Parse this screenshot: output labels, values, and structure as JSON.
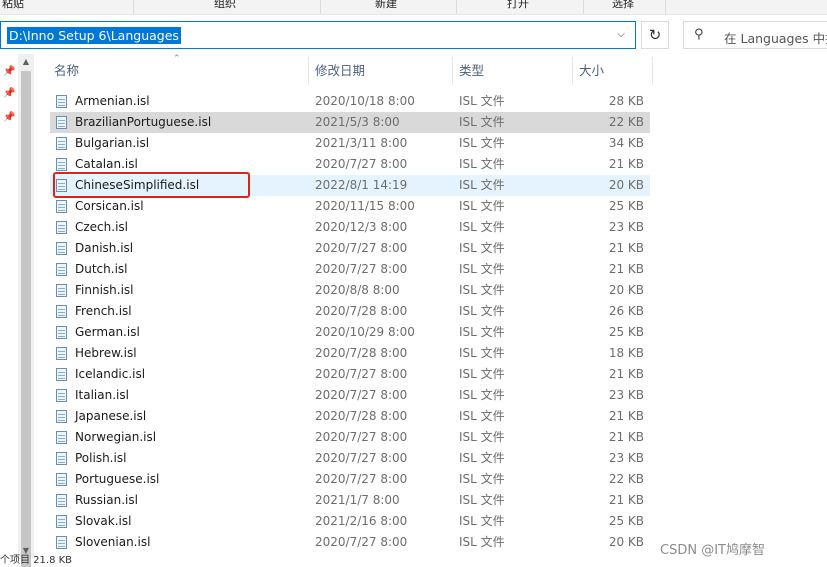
{
  "ribbon": {
    "groups": [
      "粘贴",
      "组织",
      "新建",
      "打开",
      "选择"
    ]
  },
  "address_bar": {
    "path": "D:\\Inno Setup 6\\Languages"
  },
  "search": {
    "placeholder": "在 Languages 中搜"
  },
  "columns": {
    "name": "名称",
    "modified": "修改日期",
    "type": "类型",
    "size": "大小"
  },
  "files": [
    {
      "name": "Armenian.isl",
      "modified": "2020/10/18 8:00",
      "type": "ISL 文件",
      "size": "28 KB"
    },
    {
      "name": "BrazilianPortuguese.isl",
      "modified": "2021/5/3 8:00",
      "type": "ISL 文件",
      "size": "22 KB"
    },
    {
      "name": "Bulgarian.isl",
      "modified": "2021/3/11 8:00",
      "type": "ISL 文件",
      "size": "34 KB"
    },
    {
      "name": "Catalan.isl",
      "modified": "2020/7/27 8:00",
      "type": "ISL 文件",
      "size": "21 KB"
    },
    {
      "name": "ChineseSimplified.isl",
      "modified": "2022/8/1 14:19",
      "type": "ISL 文件",
      "size": "20 KB"
    },
    {
      "name": "Corsican.isl",
      "modified": "2020/11/15 8:00",
      "type": "ISL 文件",
      "size": "25 KB"
    },
    {
      "name": "Czech.isl",
      "modified": "2020/12/3 8:00",
      "type": "ISL 文件",
      "size": "23 KB"
    },
    {
      "name": "Danish.isl",
      "modified": "2020/7/27 8:00",
      "type": "ISL 文件",
      "size": "21 KB"
    },
    {
      "name": "Dutch.isl",
      "modified": "2020/7/27 8:00",
      "type": "ISL 文件",
      "size": "21 KB"
    },
    {
      "name": "Finnish.isl",
      "modified": "2020/8/8 8:00",
      "type": "ISL 文件",
      "size": "20 KB"
    },
    {
      "name": "French.isl",
      "modified": "2020/7/28 8:00",
      "type": "ISL 文件",
      "size": "26 KB"
    },
    {
      "name": "German.isl",
      "modified": "2020/10/29 8:00",
      "type": "ISL 文件",
      "size": "25 KB"
    },
    {
      "name": "Hebrew.isl",
      "modified": "2020/7/28 8:00",
      "type": "ISL 文件",
      "size": "18 KB"
    },
    {
      "name": "Icelandic.isl",
      "modified": "2020/7/27 8:00",
      "type": "ISL 文件",
      "size": "21 KB"
    },
    {
      "name": "Italian.isl",
      "modified": "2020/7/27 8:00",
      "type": "ISL 文件",
      "size": "23 KB"
    },
    {
      "name": "Japanese.isl",
      "modified": "2020/7/28 8:00",
      "type": "ISL 文件",
      "size": "21 KB"
    },
    {
      "name": "Norwegian.isl",
      "modified": "2020/7/27 8:00",
      "type": "ISL 文件",
      "size": "21 KB"
    },
    {
      "name": "Polish.isl",
      "modified": "2020/7/27 8:00",
      "type": "ISL 文件",
      "size": "23 KB"
    },
    {
      "name": "Portuguese.isl",
      "modified": "2020/7/27 8:00",
      "type": "ISL 文件",
      "size": "22 KB"
    },
    {
      "name": "Russian.isl",
      "modified": "2021/1/7 8:00",
      "type": "ISL 文件",
      "size": "21 KB"
    },
    {
      "name": "Slovak.isl",
      "modified": "2021/2/16 8:00",
      "type": "ISL 文件",
      "size": "25 KB"
    },
    {
      "name": "Slovenian.isl",
      "modified": "2020/7/27 8:00",
      "type": "ISL 文件",
      "size": "20 KB"
    }
  ],
  "selected_index": 1,
  "hover_index": 4,
  "highlight_color": "#e0211d",
  "accent_color": "#0078d7",
  "status_bar": {
    "text": "个项目 21.8 KB"
  },
  "watermark": "CSDN @IT鸠摩智",
  "icons": {
    "file": "isl-file-icon",
    "pin": "pin-icon",
    "refresh": "refresh-icon",
    "search": "search-icon",
    "dropdown": "chevron-down-icon"
  }
}
